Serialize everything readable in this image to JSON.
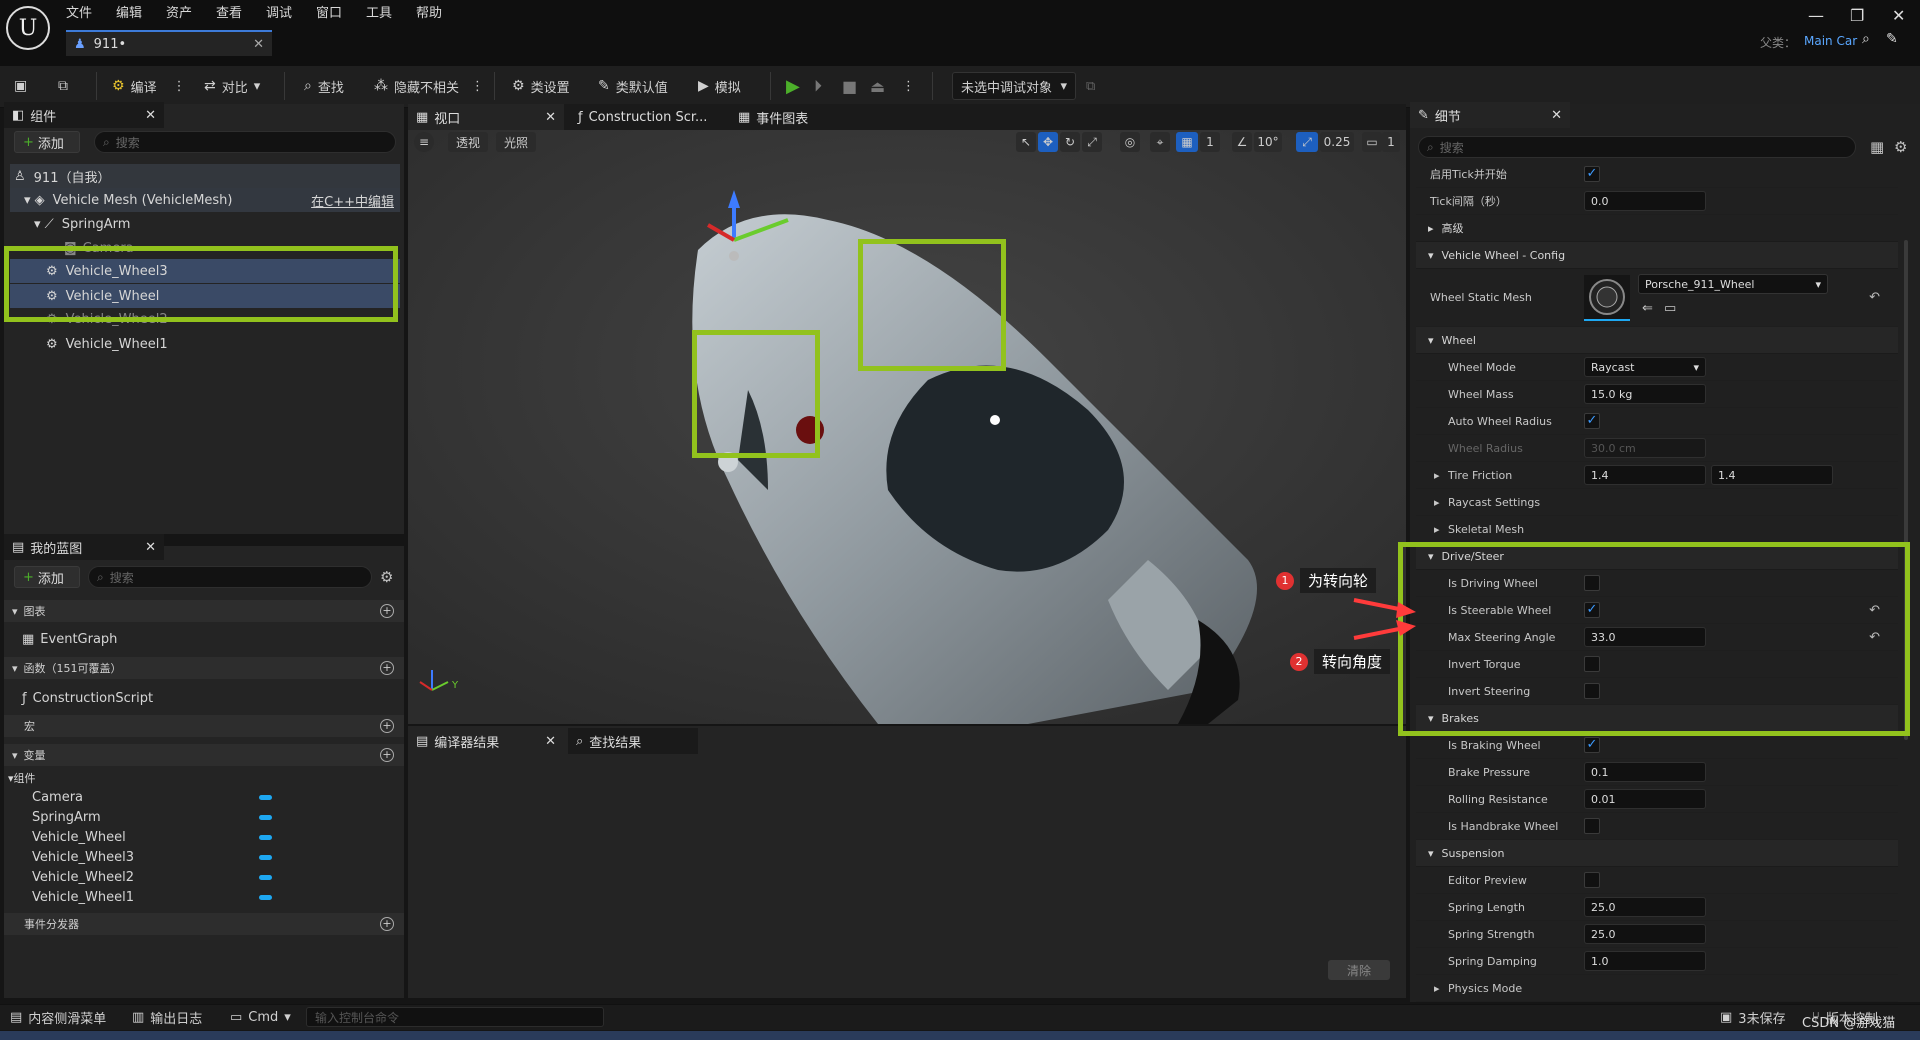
{
  "menu": [
    "文件",
    "编辑",
    "资产",
    "查看",
    "调试",
    "窗口",
    "工具",
    "帮助"
  ],
  "doc_tab": "911•",
  "parent_label": "父类：",
  "parent_value": "Main Car",
  "toolbar": {
    "compile": "编译",
    "diff": "对比",
    "find": "查找",
    "hide": "隐藏不相关",
    "class_settings": "类设置",
    "class_defaults": "类默认值",
    "simulate": "模拟",
    "debug_target": "未选中调试对象"
  },
  "components": {
    "tab": "组件",
    "add": "添加",
    "search": "搜索",
    "root": "911（自我）",
    "mesh": "Vehicle Mesh (VehicleMesh)",
    "cpp_link": "在C++中编辑",
    "items": [
      "SpringArm",
      "Camera",
      "Vehicle_Wheel3",
      "Vehicle_Wheel",
      "Vehicle_Wheel2",
      "Vehicle_Wheel1"
    ]
  },
  "myblueprint": {
    "tab": "我的蓝图",
    "add": "添加",
    "search": "搜索",
    "graphs": "图表",
    "event_graph": "EventGraph",
    "functions": "函数（151可覆盖）",
    "construction": "ConstructionScript",
    "macros": "宏",
    "variables": "变量",
    "comp_group": "组件",
    "vars": [
      "Camera",
      "SpringArm",
      "Vehicle_Wheel",
      "Vehicle_Wheel3",
      "Vehicle_Wheel2",
      "Vehicle_Wheel1"
    ],
    "dispatchers": "事件分发器"
  },
  "viewport": {
    "tab": "视口",
    "tab2": "Construction Scr...",
    "tab3": "事件图表",
    "perspective": "透视",
    "lit": "光照",
    "grid": "1",
    "angle": "10°",
    "scale": "0.25",
    "cam": "1"
  },
  "compiler": {
    "tab": "编译器结果",
    "tab2": "查找结果",
    "clear": "清除"
  },
  "details": {
    "tab": "细节",
    "search": "搜索",
    "tick_start": "启用Tick并开始",
    "tick_interval": "Tick间隔（秒）",
    "tick_interval_val": "0.0",
    "advanced": "高级",
    "wheel_config": "Vehicle Wheel - Config",
    "wheel_static_mesh": "Wheel Static Mesh",
    "mesh_value": "Porsche_911_Wheel",
    "wheel": "Wheel",
    "wheel_mode": "Wheel Mode",
    "wheel_mode_val": "Raycast",
    "wheel_mass": "Wheel Mass",
    "wheel_mass_val": "15.0 kg",
    "auto_radius": "Auto Wheel Radius",
    "wheel_radius": "Wheel Radius",
    "wheel_radius_val": "30.0 cm",
    "tire_friction": "Tire Friction",
    "tf1": "1.4",
    "tf2": "1.4",
    "raycast": "Raycast Settings",
    "skeletal": "Skeletal Mesh",
    "drive": "Drive/Steer",
    "driving": "Is Driving Wheel",
    "steerable": "Is Steerable Wheel",
    "max_steer": "Max Steering Angle",
    "max_steer_val": "33.0",
    "inv_torque": "Invert Torque",
    "inv_steer": "Invert Steering",
    "brakes": "Brakes",
    "braking": "Is Braking Wheel",
    "brake_pressure": "Brake Pressure",
    "bp_val": "0.1",
    "rolling": "Rolling Resistance",
    "rr_val": "0.01",
    "handbrake": "Is Handbrake Wheel",
    "suspension": "Suspension",
    "editor_preview": "Editor Preview",
    "spring_length": "Spring Length",
    "sl_val": "25.0",
    "spring_strength": "Spring Strength",
    "ss_val": "25.0",
    "spring_damping": "Spring Damping",
    "sd_val": "1.0",
    "physics_mode": "Physics Mode"
  },
  "annotations": {
    "a1_num": "1",
    "a1": "为转向轮",
    "a2_num": "2",
    "a2": "转向角度"
  },
  "status": {
    "content": "内容侧滑菜单",
    "output": "输出日志",
    "cmd": "Cmd",
    "cmd_placeholder": "输入控制台命令",
    "unsaved": "3未保存",
    "source": "版本控制",
    "watermark": "CSDN @游戏猫"
  },
  "colors": {
    "highlight": "#92c21d",
    "accent": "#1ea8f2",
    "play": "#4caf2a"
  }
}
